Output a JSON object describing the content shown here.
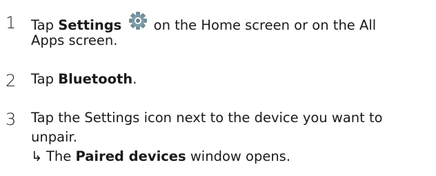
{
  "steps": [
    {
      "number": "1",
      "lines": [
        {
          "pre": "Tap ",
          "bold": "Settings",
          "post": " on the Home screen or on the All"
        },
        {
          "text": "Apps screen."
        }
      ],
      "icon": "settings-gear-icon"
    },
    {
      "number": "2",
      "pre": "Tap ",
      "bold": "Bluetooth",
      "post": "."
    },
    {
      "number": "3",
      "lines": [
        {
          "text": "Tap the Settings icon next to the device you want to"
        },
        {
          "text": "unpair."
        }
      ],
      "result": {
        "arrow": "↳",
        "pre": "The ",
        "bold": "Paired devices",
        "post": " window opens."
      }
    }
  ],
  "colors": {
    "gear": "#5f7f8f",
    "text": "#1a1a1a"
  }
}
